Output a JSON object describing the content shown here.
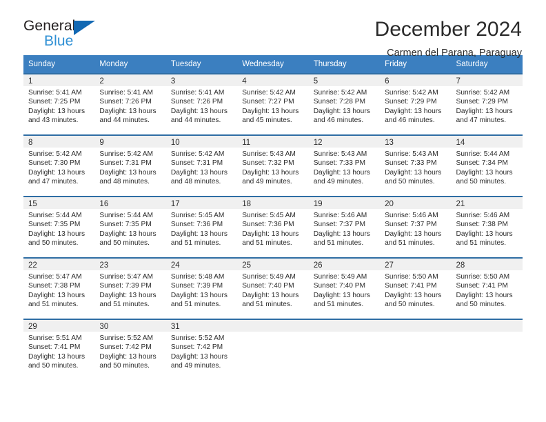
{
  "brand": {
    "name_part1": "General",
    "name_part2": "Blue",
    "triangle_color": "#1268b3",
    "blue_text_color": "#2e8fd4"
  },
  "header": {
    "title": "December 2024",
    "subtitle": "Carmen del Parana, Paraguay"
  },
  "colors": {
    "header_row_bg": "#3b7fc0",
    "cell_top_border": "#2e6da4",
    "daynum_strip_bg": "#f0f0f0",
    "text": "#2b2b2b"
  },
  "weekday_headers": [
    "Sunday",
    "Monday",
    "Tuesday",
    "Wednesday",
    "Thursday",
    "Friday",
    "Saturday"
  ],
  "weeks": [
    [
      {
        "day": "1",
        "sunrise": "Sunrise: 5:41 AM",
        "sunset": "Sunset: 7:25 PM",
        "daylight1": "Daylight: 13 hours",
        "daylight2": "and 43 minutes."
      },
      {
        "day": "2",
        "sunrise": "Sunrise: 5:41 AM",
        "sunset": "Sunset: 7:26 PM",
        "daylight1": "Daylight: 13 hours",
        "daylight2": "and 44 minutes."
      },
      {
        "day": "3",
        "sunrise": "Sunrise: 5:41 AM",
        "sunset": "Sunset: 7:26 PM",
        "daylight1": "Daylight: 13 hours",
        "daylight2": "and 44 minutes."
      },
      {
        "day": "4",
        "sunrise": "Sunrise: 5:42 AM",
        "sunset": "Sunset: 7:27 PM",
        "daylight1": "Daylight: 13 hours",
        "daylight2": "and 45 minutes."
      },
      {
        "day": "5",
        "sunrise": "Sunrise: 5:42 AM",
        "sunset": "Sunset: 7:28 PM",
        "daylight1": "Daylight: 13 hours",
        "daylight2": "and 46 minutes."
      },
      {
        "day": "6",
        "sunrise": "Sunrise: 5:42 AM",
        "sunset": "Sunset: 7:29 PM",
        "daylight1": "Daylight: 13 hours",
        "daylight2": "and 46 minutes."
      },
      {
        "day": "7",
        "sunrise": "Sunrise: 5:42 AM",
        "sunset": "Sunset: 7:29 PM",
        "daylight1": "Daylight: 13 hours",
        "daylight2": "and 47 minutes."
      }
    ],
    [
      {
        "day": "8",
        "sunrise": "Sunrise: 5:42 AM",
        "sunset": "Sunset: 7:30 PM",
        "daylight1": "Daylight: 13 hours",
        "daylight2": "and 47 minutes."
      },
      {
        "day": "9",
        "sunrise": "Sunrise: 5:42 AM",
        "sunset": "Sunset: 7:31 PM",
        "daylight1": "Daylight: 13 hours",
        "daylight2": "and 48 minutes."
      },
      {
        "day": "10",
        "sunrise": "Sunrise: 5:42 AM",
        "sunset": "Sunset: 7:31 PM",
        "daylight1": "Daylight: 13 hours",
        "daylight2": "and 48 minutes."
      },
      {
        "day": "11",
        "sunrise": "Sunrise: 5:43 AM",
        "sunset": "Sunset: 7:32 PM",
        "daylight1": "Daylight: 13 hours",
        "daylight2": "and 49 minutes."
      },
      {
        "day": "12",
        "sunrise": "Sunrise: 5:43 AM",
        "sunset": "Sunset: 7:33 PM",
        "daylight1": "Daylight: 13 hours",
        "daylight2": "and 49 minutes."
      },
      {
        "day": "13",
        "sunrise": "Sunrise: 5:43 AM",
        "sunset": "Sunset: 7:33 PM",
        "daylight1": "Daylight: 13 hours",
        "daylight2": "and 50 minutes."
      },
      {
        "day": "14",
        "sunrise": "Sunrise: 5:44 AM",
        "sunset": "Sunset: 7:34 PM",
        "daylight1": "Daylight: 13 hours",
        "daylight2": "and 50 minutes."
      }
    ],
    [
      {
        "day": "15",
        "sunrise": "Sunrise: 5:44 AM",
        "sunset": "Sunset: 7:35 PM",
        "daylight1": "Daylight: 13 hours",
        "daylight2": "and 50 minutes."
      },
      {
        "day": "16",
        "sunrise": "Sunrise: 5:44 AM",
        "sunset": "Sunset: 7:35 PM",
        "daylight1": "Daylight: 13 hours",
        "daylight2": "and 50 minutes."
      },
      {
        "day": "17",
        "sunrise": "Sunrise: 5:45 AM",
        "sunset": "Sunset: 7:36 PM",
        "daylight1": "Daylight: 13 hours",
        "daylight2": "and 51 minutes."
      },
      {
        "day": "18",
        "sunrise": "Sunrise: 5:45 AM",
        "sunset": "Sunset: 7:36 PM",
        "daylight1": "Daylight: 13 hours",
        "daylight2": "and 51 minutes."
      },
      {
        "day": "19",
        "sunrise": "Sunrise: 5:46 AM",
        "sunset": "Sunset: 7:37 PM",
        "daylight1": "Daylight: 13 hours",
        "daylight2": "and 51 minutes."
      },
      {
        "day": "20",
        "sunrise": "Sunrise: 5:46 AM",
        "sunset": "Sunset: 7:37 PM",
        "daylight1": "Daylight: 13 hours",
        "daylight2": "and 51 minutes."
      },
      {
        "day": "21",
        "sunrise": "Sunrise: 5:46 AM",
        "sunset": "Sunset: 7:38 PM",
        "daylight1": "Daylight: 13 hours",
        "daylight2": "and 51 minutes."
      }
    ],
    [
      {
        "day": "22",
        "sunrise": "Sunrise: 5:47 AM",
        "sunset": "Sunset: 7:38 PM",
        "daylight1": "Daylight: 13 hours",
        "daylight2": "and 51 minutes."
      },
      {
        "day": "23",
        "sunrise": "Sunrise: 5:47 AM",
        "sunset": "Sunset: 7:39 PM",
        "daylight1": "Daylight: 13 hours",
        "daylight2": "and 51 minutes."
      },
      {
        "day": "24",
        "sunrise": "Sunrise: 5:48 AM",
        "sunset": "Sunset: 7:39 PM",
        "daylight1": "Daylight: 13 hours",
        "daylight2": "and 51 minutes."
      },
      {
        "day": "25",
        "sunrise": "Sunrise: 5:49 AM",
        "sunset": "Sunset: 7:40 PM",
        "daylight1": "Daylight: 13 hours",
        "daylight2": "and 51 minutes."
      },
      {
        "day": "26",
        "sunrise": "Sunrise: 5:49 AM",
        "sunset": "Sunset: 7:40 PM",
        "daylight1": "Daylight: 13 hours",
        "daylight2": "and 51 minutes."
      },
      {
        "day": "27",
        "sunrise": "Sunrise: 5:50 AM",
        "sunset": "Sunset: 7:41 PM",
        "daylight1": "Daylight: 13 hours",
        "daylight2": "and 50 minutes."
      },
      {
        "day": "28",
        "sunrise": "Sunrise: 5:50 AM",
        "sunset": "Sunset: 7:41 PM",
        "daylight1": "Daylight: 13 hours",
        "daylight2": "and 50 minutes."
      }
    ],
    [
      {
        "day": "29",
        "sunrise": "Sunrise: 5:51 AM",
        "sunset": "Sunset: 7:41 PM",
        "daylight1": "Daylight: 13 hours",
        "daylight2": "and 50 minutes."
      },
      {
        "day": "30",
        "sunrise": "Sunrise: 5:52 AM",
        "sunset": "Sunset: 7:42 PM",
        "daylight1": "Daylight: 13 hours",
        "daylight2": "and 50 minutes."
      },
      {
        "day": "31",
        "sunrise": "Sunrise: 5:52 AM",
        "sunset": "Sunset: 7:42 PM",
        "daylight1": "Daylight: 13 hours",
        "daylight2": "and 49 minutes."
      },
      {
        "day": "",
        "sunrise": "",
        "sunset": "",
        "daylight1": "",
        "daylight2": ""
      },
      {
        "day": "",
        "sunrise": "",
        "sunset": "",
        "daylight1": "",
        "daylight2": ""
      },
      {
        "day": "",
        "sunrise": "",
        "sunset": "",
        "daylight1": "",
        "daylight2": ""
      },
      {
        "day": "",
        "sunrise": "",
        "sunset": "",
        "daylight1": "",
        "daylight2": ""
      }
    ]
  ]
}
